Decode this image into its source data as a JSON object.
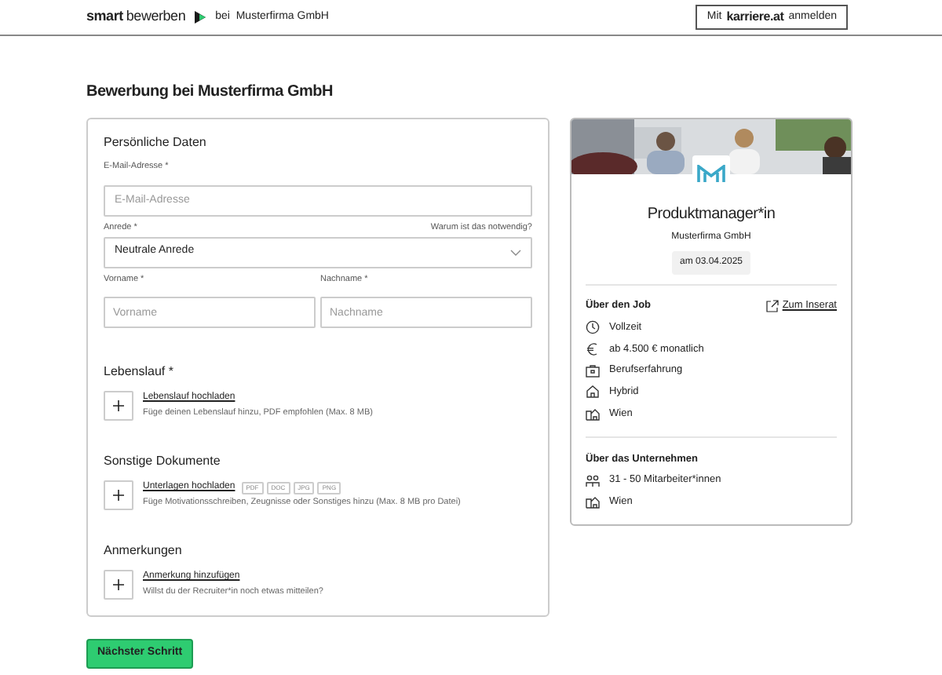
{
  "header": {
    "brand_bold": "smart",
    "brand_rest": "bewerben",
    "context": "bei  Musterfirma GmbH",
    "login": {
      "prefix": "Mit",
      "brand": "karriere.at",
      "suffix": "anmelden"
    }
  },
  "page_title": "Bewerbung bei Musterfirma GmbH",
  "personal": {
    "title": "Persönliche Daten",
    "email": {
      "label": "E-Mail-Adresse *",
      "placeholder": "E-Mail-Adresse"
    },
    "salutation": {
      "label": "Anrede *",
      "help_link": "Warum ist das notwendig?",
      "value": "Neutrale Anrede"
    },
    "first_name": {
      "label": "Vorname *",
      "placeholder": "Vorname"
    },
    "last_name": {
      "label": "Nachname *",
      "placeholder": "Nachname"
    }
  },
  "sections": [
    {
      "title": "Lebenslauf *",
      "link": "Lebenslauf hochladen",
      "hint": "Füge deinen Lebenslauf hinzu, PDF empfohlen (Max. 8 MB)"
    },
    {
      "title": "Sonstige Dokumente",
      "link": "Unterlagen hochladen",
      "tags": [
        "PDF",
        "DOC",
        "JPG",
        "PNG"
      ],
      "hint": "Füge Motivationsschreiben, Zeugnisse oder Sonstiges hinzu (Max. 8 MB pro Datei)"
    },
    {
      "title": "Anmerkungen",
      "link": "Anmerkung hinzufügen",
      "hint": "Willst du der Recruiter*in noch etwas mitteilen?"
    }
  ],
  "next_button": "Nächster Schritt",
  "job_card": {
    "title": "Produktmanager*in",
    "company": "Musterfirma GmbH",
    "date": "am 03.04.2025",
    "about_job": {
      "title": "Über den Job",
      "link": "Zum Inserat",
      "items": [
        {
          "kind": "clock",
          "text": "Vollzeit"
        },
        {
          "kind": "euro",
          "text": "ab 4.500 € monatlich"
        },
        {
          "kind": "briefcase",
          "text": "Berufserfahrung"
        },
        {
          "kind": "home",
          "text": "Hybrid"
        },
        {
          "kind": "city",
          "text": "Wien"
        }
      ]
    },
    "about_company": {
      "title": "Über das Unternehmen",
      "items": [
        {
          "kind": "people",
          "text": "31 - 50 Mitarbeiter*innen"
        },
        {
          "kind": "city",
          "text": "Wien"
        }
      ]
    }
  }
}
